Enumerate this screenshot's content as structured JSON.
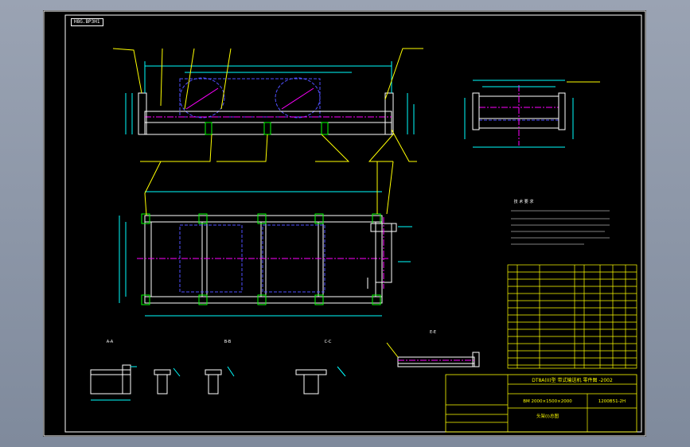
{
  "drawing": {
    "tag": "H8G.BP3H1",
    "colors": {
      "background": "#000000",
      "frame": "#ffffff",
      "outline": "#00ff00",
      "part": "#ffffff",
      "dimension": "#00ffff",
      "hidden": "#5050ff",
      "center": "#ff00ff",
      "leader": "#ffff00",
      "titleblock": "#ffff00"
    },
    "notes_heading": "技 术 要 求",
    "view_labels": [
      "A-A",
      "B-B",
      "C-C",
      "E-E"
    ],
    "title_block": {
      "main_title": "DT8A(II)型 带式输送机 零件图 -2002",
      "spec_line": "BM 2000×1500×2000",
      "drawing_no": "1200B51-2H",
      "part_name": "头架(Ⅰ)总图"
    }
  }
}
